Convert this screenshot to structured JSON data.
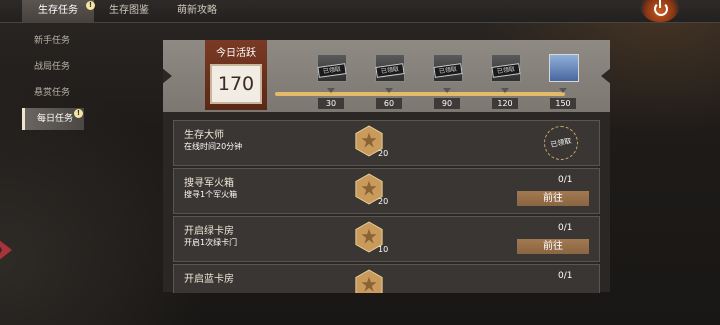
{
  "top_tabs": [
    {
      "label": "生存任务",
      "active": true,
      "alert": true
    },
    {
      "label": "生存图鉴",
      "active": false,
      "alert": false
    },
    {
      "label": "萌新攻略",
      "active": false,
      "alert": false
    }
  ],
  "sidebar": {
    "items": [
      {
        "label": "新手任务",
        "active": false
      },
      {
        "label": "战局任务",
        "active": false
      },
      {
        "label": "悬赏任务",
        "active": false
      },
      {
        "label": "每日任务",
        "active": true,
        "alert": true
      }
    ]
  },
  "activity": {
    "label": "今日活跃",
    "value": "170",
    "milestones": [
      {
        "score": "30",
        "tag": "已领取"
      },
      {
        "score": "60",
        "tag": "已领取"
      },
      {
        "score": "90",
        "tag": "已领取"
      },
      {
        "score": "120",
        "tag": "已领取"
      },
      {
        "score": "150",
        "tag": ""
      }
    ]
  },
  "tasks": [
    {
      "title": "生存大师",
      "desc": "在线时间20分钟",
      "reward": "20",
      "progress": "",
      "action": "",
      "stamp": "已领取"
    },
    {
      "title": "搜寻军火箱",
      "desc": "搜寻1个军火箱",
      "reward": "20",
      "progress": "0/1",
      "action": "前往",
      "stamp": ""
    },
    {
      "title": "开启绿卡房",
      "desc": "开启1次绿卡门",
      "reward": "10",
      "progress": "0/1",
      "action": "前往",
      "stamp": ""
    },
    {
      "title": "开启蓝卡房",
      "desc": "",
      "reward": "",
      "progress": "0/1",
      "action": "",
      "stamp": ""
    }
  ],
  "alert_glyph": "!",
  "colors": {
    "accent": "#8a6541",
    "active_box": "#7a3a24",
    "track": "#e3b96a"
  }
}
